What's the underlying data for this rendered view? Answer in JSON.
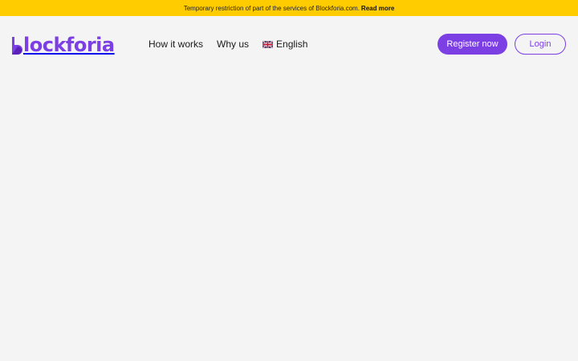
{
  "banner": {
    "text": "Temporary restriction of part of the services of Blockforia.com.",
    "link": "Read more"
  },
  "header": {
    "logo_text": "lockforia",
    "nav": {
      "how_it_works": "How it works",
      "why_us": "Why us",
      "language": "English"
    },
    "register_label": "Register now",
    "login_label": "Login"
  },
  "colors": {
    "brand": "#7b3fe4",
    "banner": "#ffcc00",
    "background": "#f4f4f5"
  }
}
